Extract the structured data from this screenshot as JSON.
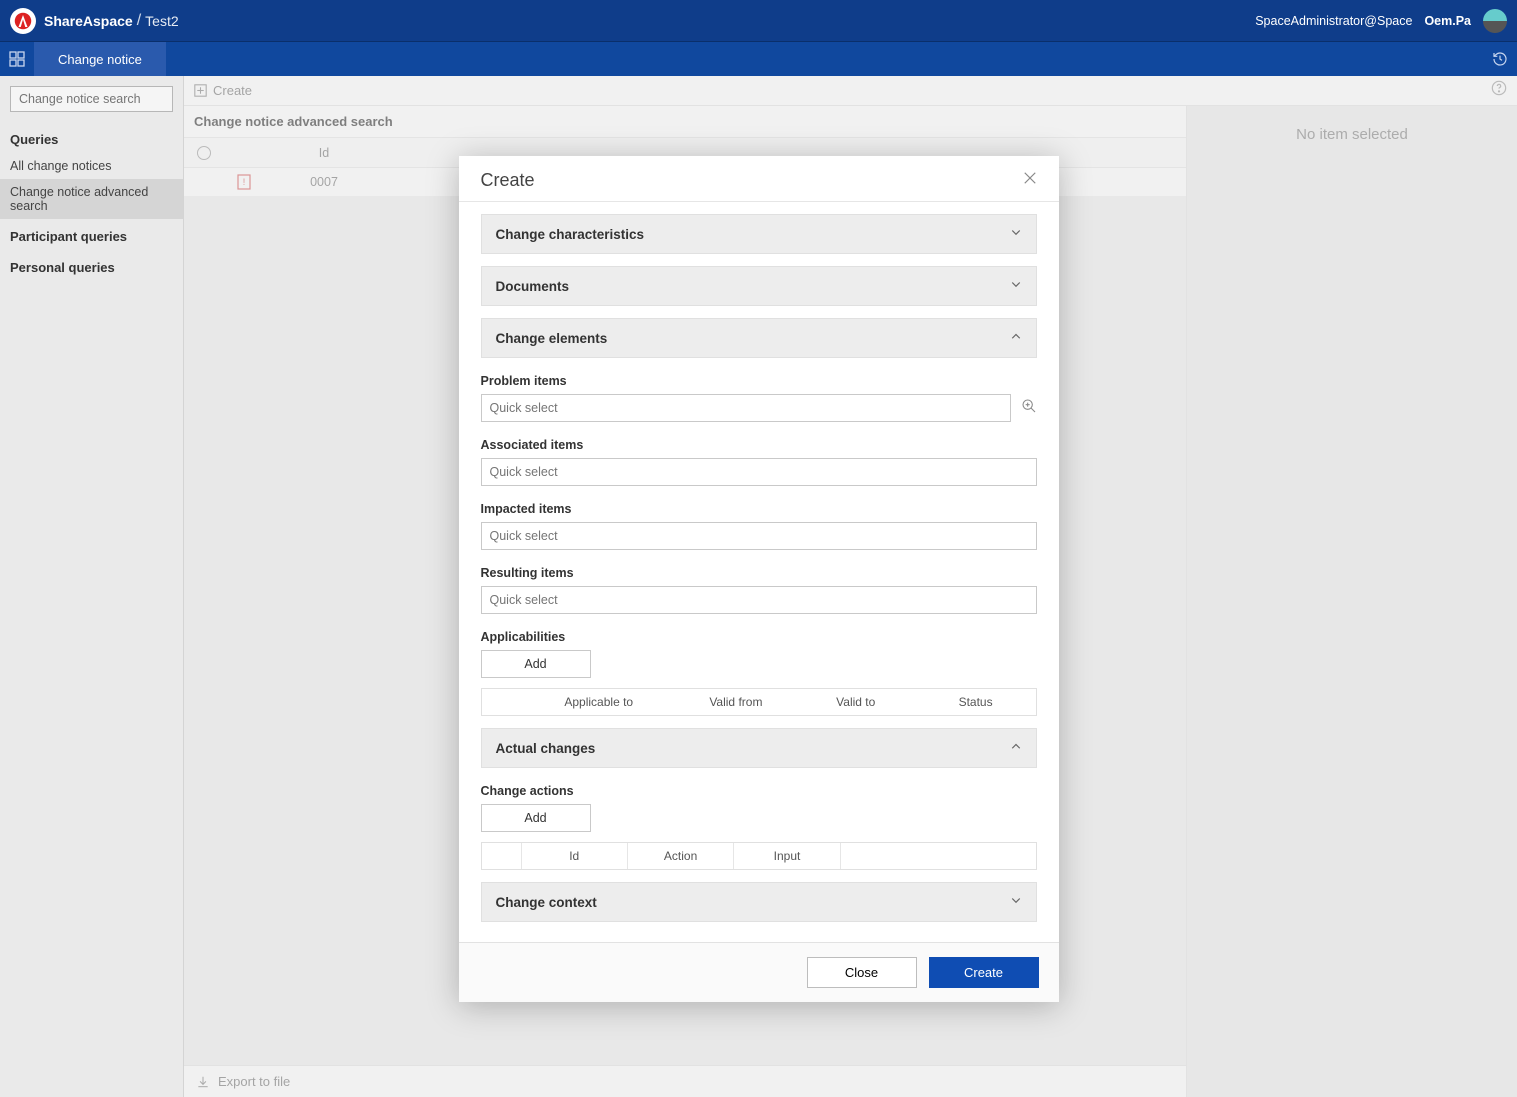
{
  "header": {
    "brand": "ShareAspace",
    "context": "Test2",
    "role": "SpaceAdministrator@Space",
    "user": "Oem.Pa"
  },
  "tabs": {
    "active": "Change notice"
  },
  "sidebar": {
    "search_placeholder": "Change notice search",
    "queries_label": "Queries",
    "items": {
      "all": "All change notices",
      "advanced": "Change notice advanced search"
    },
    "participant_label": "Participant queries",
    "personal_label": "Personal queries"
  },
  "main": {
    "create_label": "Create",
    "list_title": "Change notice advanced search",
    "col_id": "Id",
    "rows": [
      {
        "id": "0007"
      }
    ],
    "export_label": "Export to file",
    "no_item": "No item selected"
  },
  "modal": {
    "title": "Create",
    "sections": {
      "char": "Change characteristics",
      "docs": "Documents",
      "elements": "Change elements",
      "actual": "Actual changes",
      "context": "Change context"
    },
    "fields": {
      "problem": "Problem items",
      "associated": "Associated items",
      "impacted": "Impacted items",
      "resulting": "Resulting items",
      "applicabilities": "Applicabilities",
      "change_actions": "Change actions"
    },
    "quick_select": "Quick select",
    "add_label": "Add",
    "app_cols": {
      "applicable_to": "Applicable to",
      "valid_from": "Valid from",
      "valid_to": "Valid to",
      "status": "Status"
    },
    "ca_cols": {
      "id": "Id",
      "action": "Action",
      "input": "Input"
    },
    "buttons": {
      "close": "Close",
      "create": "Create"
    }
  }
}
